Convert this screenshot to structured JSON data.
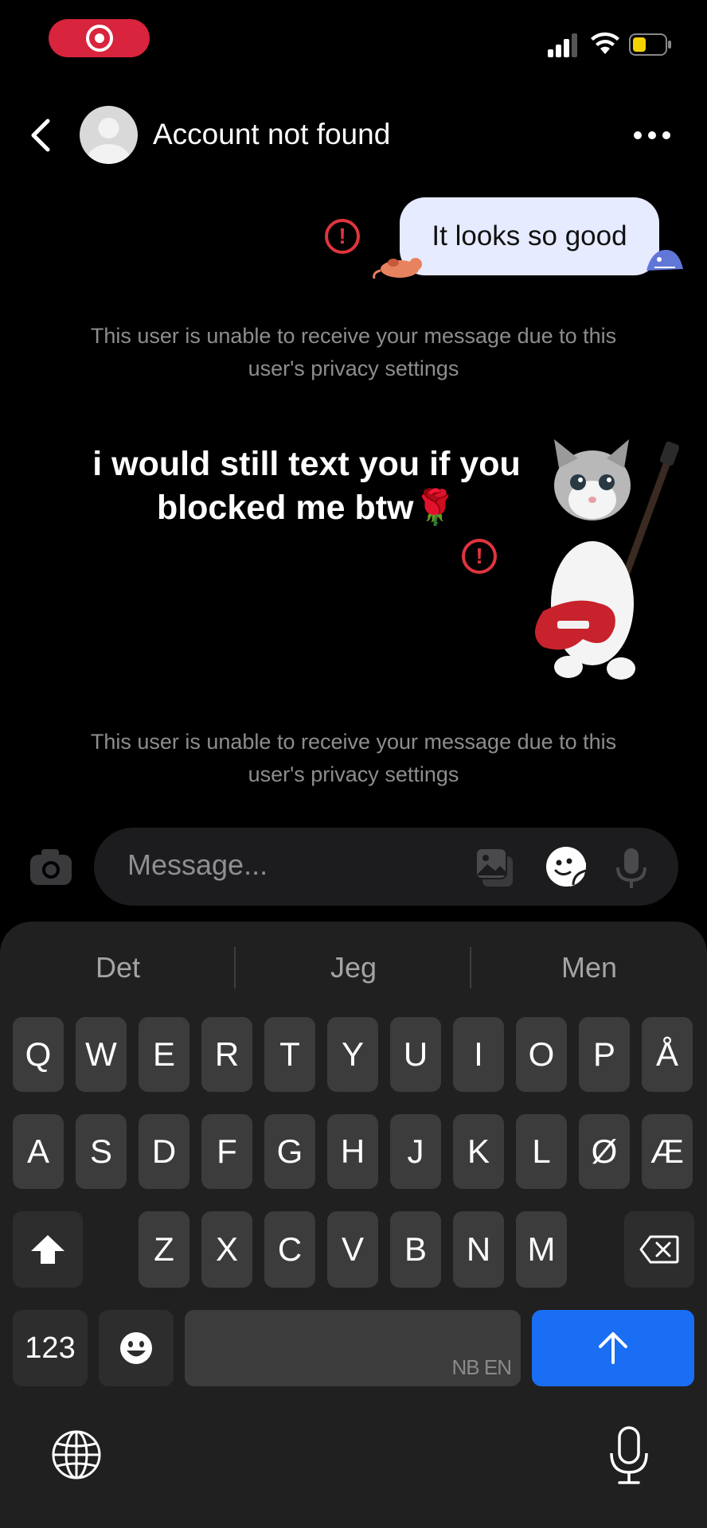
{
  "header": {
    "title": "Account not found"
  },
  "messages": [
    {
      "text": "It looks so good",
      "status": "failed"
    },
    {
      "text": "i would still text you if you blocked me btw🌹",
      "status": "failed"
    }
  ],
  "notices": [
    "This user is unable to receive your message due to this user's privacy settings",
    "This user is unable to receive your message due to this user's privacy settings"
  ],
  "composer": {
    "placeholder": "Message..."
  },
  "keyboard": {
    "suggestions": [
      "Det",
      "Jeg",
      "Men"
    ],
    "row1": [
      "Q",
      "W",
      "E",
      "R",
      "T",
      "Y",
      "U",
      "I",
      "O",
      "P",
      "Å"
    ],
    "row2": [
      "A",
      "S",
      "D",
      "F",
      "G",
      "H",
      "J",
      "K",
      "L",
      "Ø",
      "Æ"
    ],
    "row3": [
      "Z",
      "X",
      "C",
      "V",
      "B",
      "N",
      "M"
    ],
    "numbers_label": "123",
    "space_language": "NB EN"
  },
  "colors": {
    "accent_send": "#1a6ef3",
    "error": "#e0343f",
    "bubble": "#e6ebff",
    "recording": "#d8243c"
  },
  "icons": [
    "record-icon",
    "signal-icon",
    "wifi-icon",
    "battery-icon",
    "back-icon",
    "avatar-icon",
    "more-icon",
    "error-icon",
    "camera-icon",
    "gallery-icon",
    "sticker-icon",
    "mic-icon",
    "shift-icon",
    "backspace-icon",
    "emoji-icon",
    "send-arrow-icon",
    "globe-icon",
    "dictation-mic-icon"
  ]
}
